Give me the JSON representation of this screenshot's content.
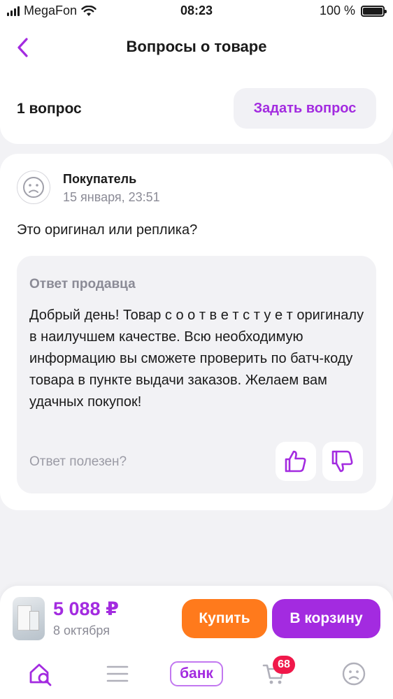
{
  "status_bar": {
    "carrier": "MegaFon",
    "time": "08:23",
    "battery_text": "100 %",
    "icons": [
      "signal-icon",
      "wifi-icon",
      "battery-icon"
    ]
  },
  "header": {
    "title": "Вопросы о товаре",
    "back_icon": "chevron-left-icon"
  },
  "questions_bar": {
    "count_label": "1 вопрос",
    "ask_button_label": "Задать вопрос"
  },
  "question": {
    "author": "Покупатель",
    "date": "15 января, 23:51",
    "text": "Это оригинал или реплика?",
    "avatar_icon": "user-avatar-icon",
    "answer": {
      "title": "Ответ продавца",
      "text": "Добрый день! Товар с о о т в е т с т у е т оригиналу в наилучшем качестве. Всю необходимую информацию вы сможете проверить по батч-коду товара в пункте выдачи заказов. Желаем вам удачных покупок!",
      "helpful_label": "Ответ полезен?",
      "vote_icons": [
        "thumbs-up-icon",
        "thumbs-down-icon"
      ]
    }
  },
  "buy_bar": {
    "price": "5 088 ₽",
    "delivery_date": "8 октября",
    "buy_label": "Купить",
    "cart_label": "В корзину"
  },
  "tab_bar": {
    "items": [
      "home-search-icon",
      "catalog-icon",
      "bank-tab",
      "cart-icon",
      "profile-icon"
    ],
    "bank_label": "банк",
    "cart_badge": "68"
  },
  "colors": {
    "accent": "#a32be0",
    "buy_button": "#ff7a1c",
    "badge": "#f0184a",
    "background": "#f2f2f5",
    "secondary_text": "#8b8b96"
  }
}
